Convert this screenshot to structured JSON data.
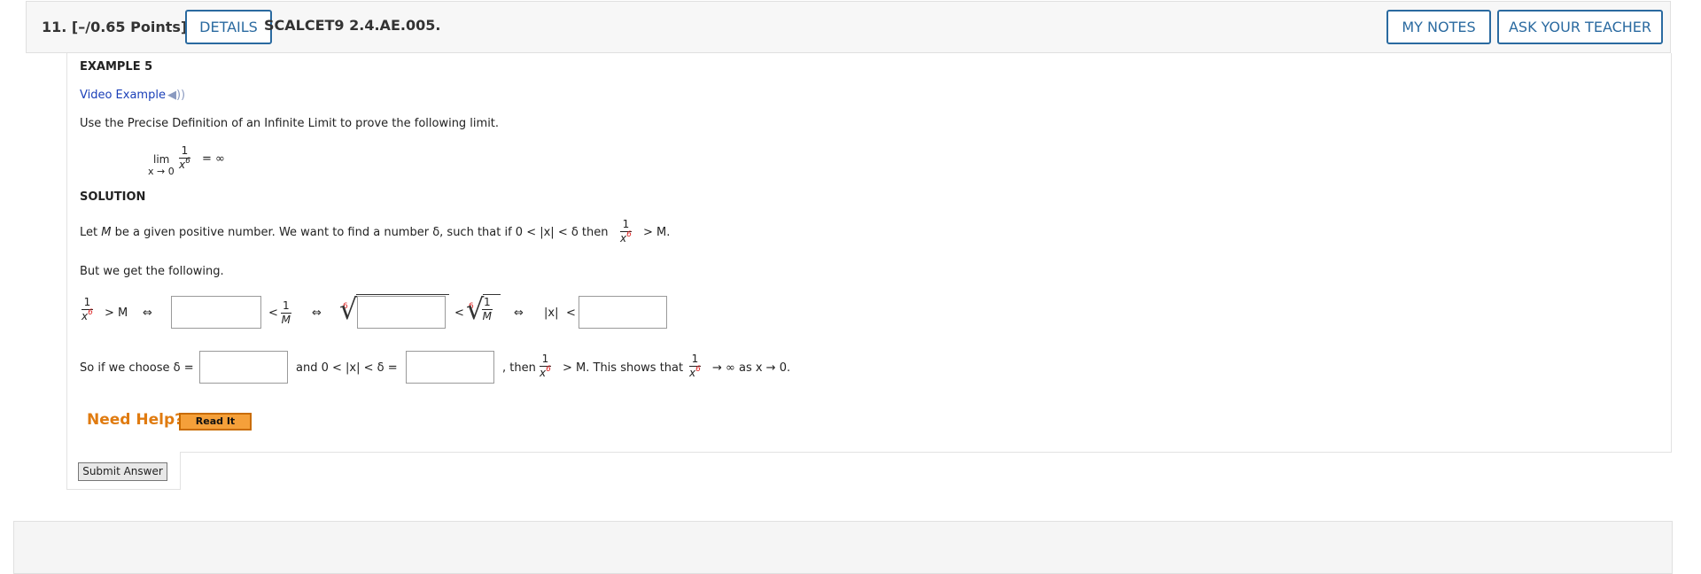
{
  "question": {
    "number": "11.",
    "points": "[–/0.65 Points]",
    "details_label": "DETAILS",
    "code": "SCALCET9 2.4.AE.005.",
    "my_notes_label": "MY NOTES",
    "ask_teacher_label": "ASK YOUR TEACHER"
  },
  "example": {
    "heading": "EXAMPLE 5",
    "video_link": "Video Example",
    "intro": "Use the Precise Definition of an Infinite Limit to prove the following limit.",
    "lim_word": "lim",
    "lim_sub": "x → 0",
    "num_one": "1",
    "x_var": "x",
    "exponent": "6",
    "equals_infinity": "= ∞"
  },
  "solution": {
    "heading": "SOLUTION",
    "line1_prefix": "Let",
    "m_var": "M",
    "line1_middle": "be a given positive number. We want to find a number δ, such that if 0 < |x| < δ then",
    "line1_suffix": "> M.",
    "line2": "But we get the following.",
    "gt_m": "> M",
    "iff": "⇔",
    "lt": "<",
    "abs_x": "|x|",
    "line3_prefix": "So if we choose δ =",
    "line3_mid": "and 0 < |x| < δ =",
    "line3_then": ", then",
    "line3_shows": "> M. This shows that",
    "line3_end": "→ ∞ as x → 0."
  },
  "inputs": {
    "box1": "",
    "box2": "",
    "box3": "",
    "delta1": "",
    "delta2": ""
  },
  "help": {
    "need_help": "Need Help?",
    "read_it": "Read It"
  },
  "submit_label": "Submit Answer",
  "colors": {
    "accent_blue": "#2a6aa0",
    "link_blue": "#1a3fb8",
    "help_orange": "#e07b10",
    "readit_bg": "#f5a03a",
    "exponent_red": "#d22222"
  }
}
